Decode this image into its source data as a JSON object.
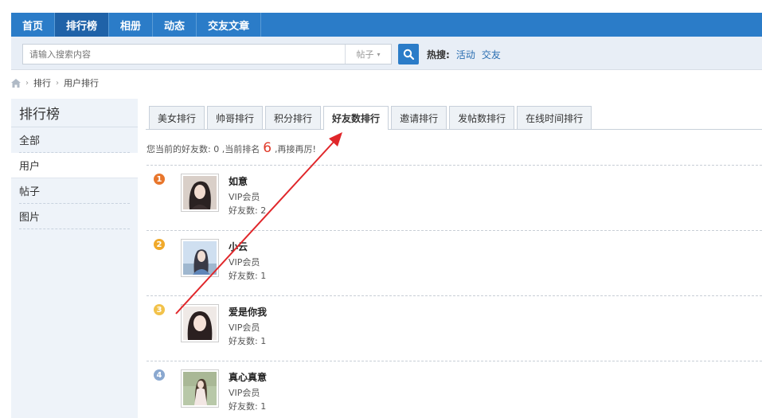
{
  "nav": {
    "items": [
      {
        "label": "首页"
      },
      {
        "label": "排行榜",
        "active": true
      },
      {
        "label": "相册"
      },
      {
        "label": "动态"
      },
      {
        "label": "交友文章"
      }
    ]
  },
  "search": {
    "placeholder": "请输入搜索内容",
    "type_selected": "帖子",
    "hot_label": "热搜:",
    "hot_links": [
      "活动",
      "交友"
    ]
  },
  "breadcrumb": {
    "items": [
      "排行",
      "用户排行"
    ]
  },
  "sidebar": {
    "title": "排行榜",
    "items": [
      {
        "label": "全部"
      },
      {
        "label": "用户",
        "active": true
      },
      {
        "label": "帖子"
      },
      {
        "label": "图片"
      }
    ]
  },
  "tabs": [
    {
      "label": "美女排行"
    },
    {
      "label": "帅哥排行"
    },
    {
      "label": "积分排行"
    },
    {
      "label": "好友数排行",
      "active": true
    },
    {
      "label": "邀请排行"
    },
    {
      "label": "发帖数排行"
    },
    {
      "label": "在线时间排行"
    }
  ],
  "status": {
    "prefix": "您当前的好友数: 0 ,当前排名",
    "rank": "6",
    "suffix": ",再接再厉!"
  },
  "ranking": [
    {
      "rank": "1",
      "name": "如意",
      "level": "VIP会员",
      "friends": "好友数: 2",
      "badge_color": "#e8762c"
    },
    {
      "rank": "2",
      "name": "小云",
      "level": "VIP会员",
      "friends": "好友数: 1",
      "badge_color": "#f0a92a"
    },
    {
      "rank": "3",
      "name": "爱是你我",
      "level": "VIP会员",
      "friends": "好友数: 1",
      "badge_color": "#f2c24a"
    },
    {
      "rank": "4",
      "name": "真心真意",
      "level": "VIP会员",
      "friends": "好友数: 1",
      "badge_color": "#8aa8d0"
    }
  ],
  "colors": {
    "nav_bg": "#2b7cc8",
    "accent_red": "#e03a2a"
  }
}
